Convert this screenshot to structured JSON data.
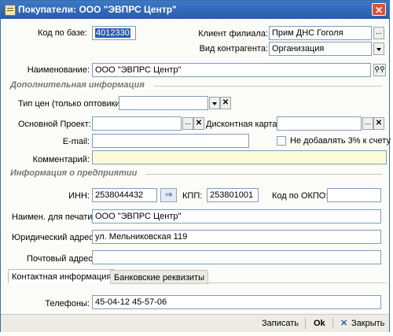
{
  "window": {
    "title": "Покупатели: ООО \"ЭВПРС Центр\""
  },
  "fields": {
    "code_label": "Код по базе:",
    "code_value": "4012330",
    "branch_client_label": "Клиент филиала:",
    "branch_client_value": "Прим ДНС  Гоголя",
    "counterparty_type_label": "Вид контрагента:",
    "counterparty_type_value": "Организация",
    "name_label": "Наименование:",
    "name_value": "ООО \"ЭВПРС Центр\""
  },
  "sections": {
    "additional": "Дополнительная информация",
    "enterprise": "Информация о предприятии"
  },
  "additional": {
    "price_type_label": "Тип цен (только оптовики):",
    "price_type_value": "",
    "main_project_label": "Основной Проект:",
    "main_project_value": "",
    "discount_card_label": "Дисконтная карта:",
    "discount_card_value": "",
    "email_label": "E-mail:",
    "email_value": "",
    "no_3pct_label": "Не добавлять 3% к счету",
    "comment_label": "Комментарий:",
    "comment_value": ""
  },
  "enterprise": {
    "inn_label": "ИНН:",
    "inn_value": "2538044432",
    "kpp_label": "КПП:",
    "kpp_value": "253801001",
    "okpo_label": "Код по ОКПО:",
    "okpo_value": "",
    "print_name_label": "Наимен. для печати:",
    "print_name_value": "ООО \"ЭВПРС Центр\"",
    "legal_address_label": "Юридический адрес:",
    "legal_address_value": "ул. Мельниковская 119",
    "postal_address_label": "Почтовый адрес:",
    "postal_address_value": ""
  },
  "tabs": [
    {
      "label": "Контактная информация",
      "active": true
    },
    {
      "label": "Банковские реквизиты",
      "active": false
    }
  ],
  "contact": {
    "phones_label": "Телефоны:",
    "phones_value": "45-04-12  45-57-06"
  },
  "footer": {
    "write_label": "Записать",
    "ok_label": "Ok",
    "close_label": "Закрыть"
  }
}
